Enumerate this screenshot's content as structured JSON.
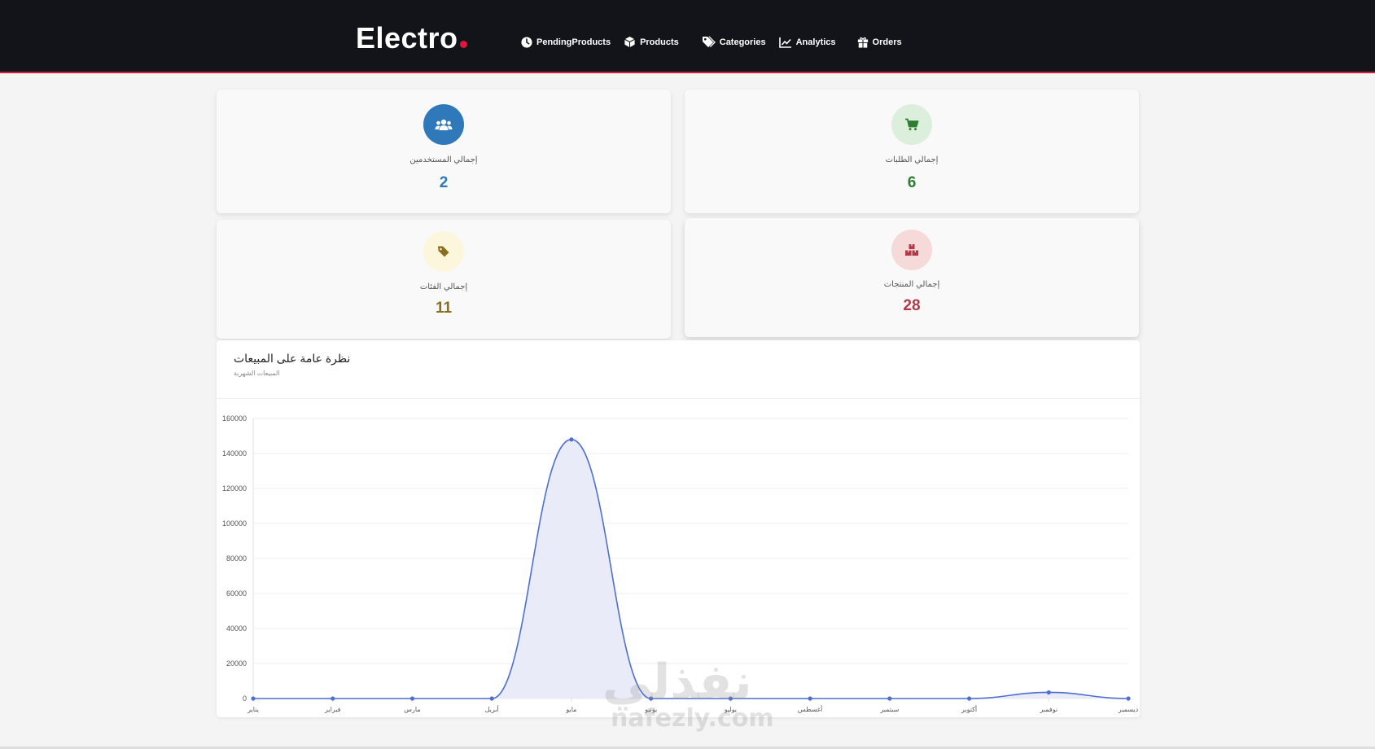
{
  "brand": {
    "name": "Electro",
    "accent": "#e0143c"
  },
  "nav": [
    {
      "label": "PendingProducts",
      "icon": "clock-icon"
    },
    {
      "label": "Products",
      "icon": "box-icon"
    },
    {
      "label": "Categories",
      "icon": "tags-icon"
    },
    {
      "label": "Analytics",
      "icon": "chart-line-icon"
    },
    {
      "label": "Orders",
      "icon": "gift-icon"
    }
  ],
  "stats": {
    "orders": {
      "label": "إجمالي الطلبات",
      "value": "6",
      "color": "#2e7d32",
      "icon": "cart-icon"
    },
    "users": {
      "label": "إجمالي المستخدمين",
      "value": "2",
      "color": "#2f79bb",
      "icon": "users-icon"
    },
    "products": {
      "label": "إجمالي المنتجات",
      "value": "28",
      "color": "#b23a48",
      "icon": "boxes-icon"
    },
    "categories": {
      "label": "إجمالي الفئات",
      "value": "11",
      "color": "#8a6d1d",
      "icon": "tag-icon"
    }
  },
  "chart": {
    "title": "نظرة عامة على المبيعات",
    "subtitle": "المبيعات الشهرية"
  },
  "chart_data": {
    "type": "area",
    "categories": [
      "يناير",
      "فبراير",
      "مارس",
      "أبريل",
      "مايو",
      "يونيو",
      "يوليو",
      "أغسطس",
      "سبتمبر",
      "أكتوبر",
      "نوفمبر",
      "ديسمبر"
    ],
    "series": [
      {
        "values": [
          0,
          0,
          0,
          0,
          148000,
          0,
          0,
          0,
          0,
          0,
          3500,
          0
        ]
      }
    ],
    "ylim": [
      0,
      160000
    ],
    "yticks": [
      0,
      20000,
      40000,
      60000,
      80000,
      100000,
      120000,
      140000,
      160000
    ],
    "grid": true,
    "legend": "none",
    "line_color": "#4f6fce",
    "fill_color": "#e9ecf8"
  },
  "watermark": {
    "arabic": "نفذلي",
    "latin": "nafezly.com"
  }
}
